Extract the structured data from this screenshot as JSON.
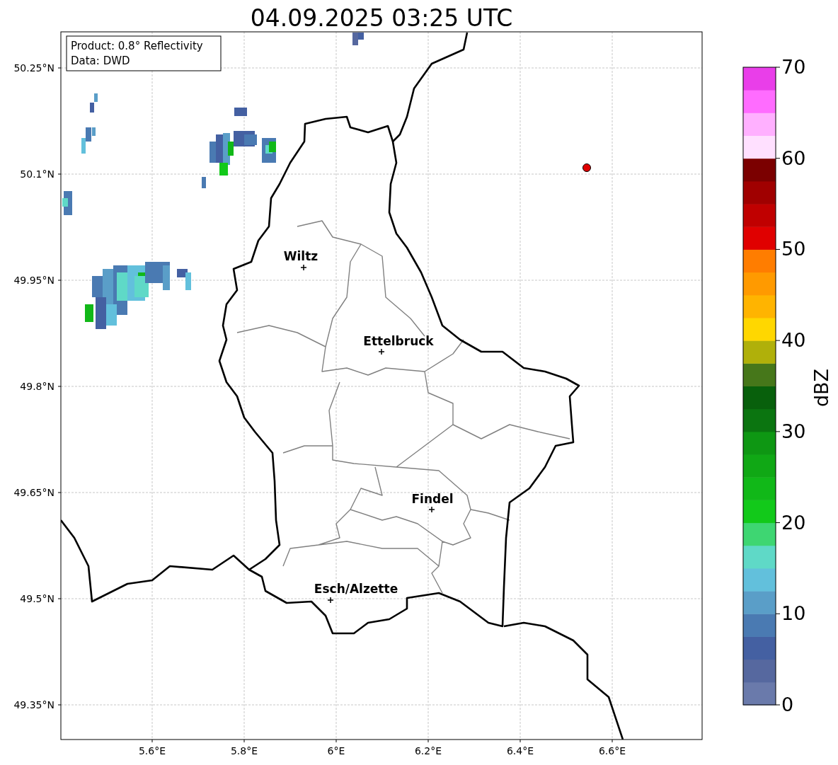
{
  "title": "04.09.2025 03:25 UTC",
  "info_box": [
    "Product: 0.8° Reflectivity",
    "Data: DWD"
  ],
  "map": {
    "lat_ticks": [
      "50.25°N",
      "50.1°N",
      "49.95°N",
      "49.8°N",
      "49.65°N",
      "49.5°N",
      "49.35°N"
    ],
    "lon_ticks": [
      "5.6°E",
      "5.8°E",
      "6°E",
      "6.2°E",
      "6.4°E",
      "6.6°E"
    ],
    "cities": [
      {
        "name": "Wiltz"
      },
      {
        "name": "Ettelbruck"
      },
      {
        "name": "Findel"
      },
      {
        "name": "Esch/Alzette"
      }
    ]
  },
  "colorbar": {
    "label": "dBZ",
    "ticks": [
      "70",
      "60",
      "50",
      "40",
      "30",
      "20",
      "10",
      "0"
    ],
    "bins": [
      {
        "color": "#6a7aab"
      },
      {
        "color": "#56689f"
      },
      {
        "color": "#4460a2"
      },
      {
        "color": "#4a7ab2"
      },
      {
        "color": "#5a9ec8"
      },
      {
        "color": "#62c0dc"
      },
      {
        "color": "#5fd9c7"
      },
      {
        "color": "#3ed672"
      },
      {
        "color": "#12c91a"
      },
      {
        "color": "#11b818"
      },
      {
        "color": "#10a815"
      },
      {
        "color": "#0e9713"
      },
      {
        "color": "#0b7510"
      },
      {
        "color": "#08600c"
      },
      {
        "color": "#46771a"
      },
      {
        "color": "#b0b00a"
      },
      {
        "color": "#ffd700"
      },
      {
        "color": "#ffb400"
      },
      {
        "color": "#ff9a00"
      },
      {
        "color": "#ff7d00"
      },
      {
        "color": "#e00000"
      },
      {
        "color": "#c00000"
      },
      {
        "color": "#a00000"
      },
      {
        "color": "#7b0000"
      },
      {
        "color": "#ffe0ff"
      },
      {
        "color": "#ffb0ff"
      },
      {
        "color": "#ff6cff"
      },
      {
        "color": "#e93ee9"
      }
    ]
  }
}
